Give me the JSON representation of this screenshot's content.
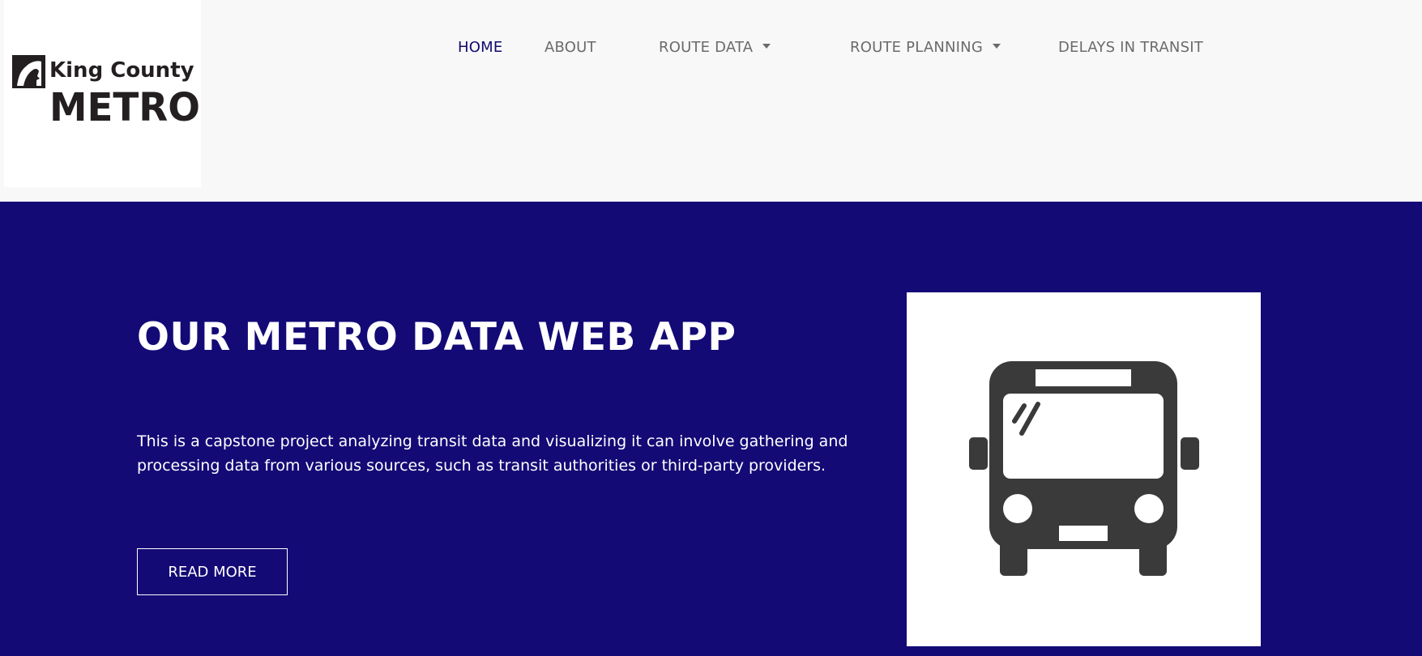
{
  "logo": {
    "line1": "King County",
    "line2": "METRO",
    "icon": "king-county-emblem-icon"
  },
  "nav": {
    "items": [
      {
        "label": "HOME",
        "active": true,
        "dropdown": false
      },
      {
        "label": "ABOUT",
        "active": false,
        "dropdown": false
      },
      {
        "label": "ROUTE DATA",
        "active": false,
        "dropdown": true
      },
      {
        "label": "ROUTE PLANNING",
        "active": false,
        "dropdown": true
      },
      {
        "label": "DELAYS IN TRANSIT",
        "active": false,
        "dropdown": false
      }
    ]
  },
  "hero": {
    "title": "OUR METRO DATA WEB APP",
    "description": "This is a capstone project analyzing transit data and visualizing it can involve gathering and processing data from various sources, such as transit authorities or third-party providers.",
    "button_label": "READ MORE",
    "image_icon": "bus-icon"
  },
  "colors": {
    "hero_background": "#130a76",
    "header_background": "#f8f8f8",
    "nav_active": "#120a6e",
    "nav_inactive": "#6b6b6b",
    "bus_icon": "#3a3a3a"
  }
}
